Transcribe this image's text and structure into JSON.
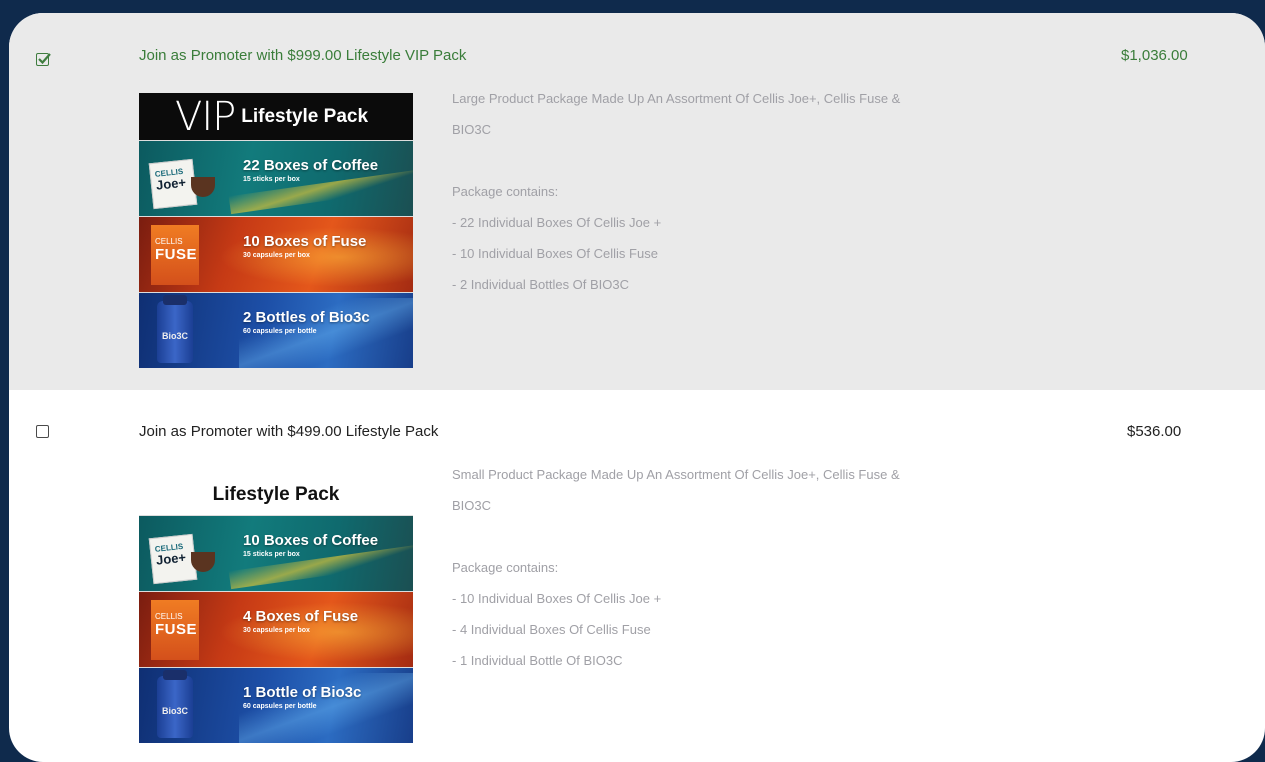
{
  "options": [
    {
      "selected": true,
      "title": "Join as Promoter with $999.00 Lifestyle VIP Pack",
      "price": "$1,036.00",
      "image": {
        "header_vip": "VIP",
        "header_title": "Lifestyle Pack",
        "bands": [
          {
            "kind": "coffee",
            "product_brand": "CELLIS",
            "product_name": "Joe+",
            "headline": "22 Boxes of Coffee",
            "subline": "15 sticks per box"
          },
          {
            "kind": "fuse",
            "product_brand": "CELLIS",
            "product_name": "FUSE",
            "headline": "10 Boxes of Fuse",
            "subline": "30 capsules per box"
          },
          {
            "kind": "bio",
            "product_name": "Bio3C",
            "headline": "2 Bottles of Bio3c",
            "subline": "60 capsules per bottle"
          }
        ]
      },
      "description": {
        "summary_line1": "Large Product Package Made Up An Assortment Of Cellis Joe+, Cellis Fuse &",
        "summary_line2": "BIO3C",
        "contains_label": "Package contains:",
        "items": [
          "- 22 Individual Boxes Of Cellis Joe +",
          "- 10 Individual Boxes Of Cellis Fuse",
          "- 2 Individual Bottles Of BIO3C"
        ]
      }
    },
    {
      "selected": false,
      "title": "Join as Promoter with $499.00 Lifestyle Pack",
      "price": "$536.00",
      "image": {
        "header_title": "Lifestyle Pack",
        "bands": [
          {
            "kind": "coffee",
            "product_brand": "CELLIS",
            "product_name": "Joe+",
            "headline": "10 Boxes of Coffee",
            "subline": "15 sticks per box"
          },
          {
            "kind": "fuse",
            "product_brand": "CELLIS",
            "product_name": "FUSE",
            "headline": "4 Boxes of Fuse",
            "subline": "30 capsules per box"
          },
          {
            "kind": "bio",
            "product_name": "Bio3C",
            "headline": "1 Bottle of Bio3c",
            "subline": "60 capsules per bottle"
          }
        ]
      },
      "description": {
        "summary_line1": "Small Product Package Made Up An Assortment Of Cellis Joe+, Cellis Fuse &",
        "summary_line2": "BIO3C",
        "contains_label": "Package contains:",
        "items": [
          "- 10 Individual Boxes Of Cellis Joe +",
          "- 4 Individual Boxes Of Cellis Fuse",
          "- 1 Individual Bottle Of BIO3C"
        ]
      }
    }
  ],
  "colors": {
    "selected_text": "#3a7d3a",
    "selected_background": "#eaeaea",
    "description_text": "#a0a0a6",
    "outer_background": "#0f2a4c"
  }
}
